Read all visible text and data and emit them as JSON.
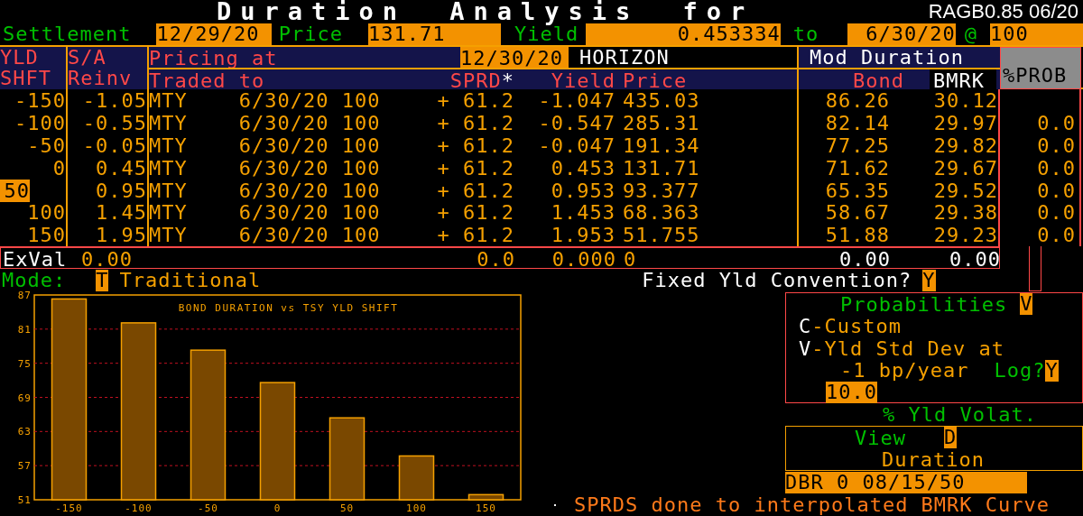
{
  "header": {
    "title": "Duration Analysis for",
    "security": "RAGB0.85 06/20"
  },
  "settlement": {
    "label": "Settlement",
    "value": "12/29/20"
  },
  "price": {
    "label": "Price",
    "value": "131.71"
  },
  "yield": {
    "label": "Yield",
    "value": "0.453334"
  },
  "to": {
    "label": "to",
    "value": "6/30/20"
  },
  "at": {
    "label": "@",
    "value": "100"
  },
  "table": {
    "yld_header": [
      "YLD",
      "SHFT"
    ],
    "sa_header": [
      "S/A",
      "Reinv"
    ],
    "pricing_label": "Pricing at",
    "pricing_date": "12/30/20",
    "horizon": "HORIZON",
    "traded_to": "Traded to",
    "sprd": "SPRD",
    "sprd_mark": "*",
    "yield": "Yield",
    "price": "Price",
    "mod_duration": "Mod Duration",
    "bond": "Bond",
    "bmrk": "BMRK",
    "prob": "%PROB",
    "rows": [
      {
        "shift": "-150",
        "reinv": "-1.05",
        "traded_to": "MTY    6/30/20 100",
        "sprd": "+ 61.2",
        "yield": "-1.047",
        "price": "435.03",
        "bond": "86.26",
        "bmrk": "30.12",
        "selected": false
      },
      {
        "shift": "-100",
        "reinv": "-0.55",
        "traded_to": "MTY    6/30/20 100",
        "sprd": "+ 61.2",
        "yield": "-0.547",
        "price": "285.31",
        "bond": "82.14",
        "bmrk": "29.97",
        "prob": "0.0",
        "selected": false
      },
      {
        "shift": "-50",
        "reinv": "-0.05",
        "traded_to": "MTY    6/30/20 100",
        "sprd": "+ 61.2",
        "yield": "-0.047",
        "price": "191.34",
        "bond": "77.25",
        "bmrk": "29.82",
        "prob": "0.0",
        "selected": false
      },
      {
        "shift": "0",
        "reinv": "0.45",
        "traded_to": "MTY    6/30/20 100",
        "sprd": "+ 61.2",
        "yield": "0.453",
        "price": "131.71",
        "bond": "71.62",
        "bmrk": "29.67",
        "prob": "0.0",
        "selected": false
      },
      {
        "shift": "50",
        "reinv": "0.95",
        "traded_to": "MTY    6/30/20 100",
        "sprd": "+ 61.2",
        "yield": "0.953",
        "price": "93.377",
        "bond": "65.35",
        "bmrk": "29.52",
        "prob": "0.0",
        "selected": true
      },
      {
        "shift": "100",
        "reinv": "1.45",
        "traded_to": "MTY    6/30/20 100",
        "sprd": "+ 61.2",
        "yield": "1.453",
        "price": "68.363",
        "bond": "58.67",
        "bmrk": "29.38",
        "prob": "0.0",
        "selected": false
      },
      {
        "shift": "150",
        "reinv": "1.95",
        "traded_to": "MTY    6/30/20 100",
        "sprd": "+ 61.2",
        "yield": "1.953",
        "price": "51.755",
        "bond": "51.88",
        "bmrk": "29.23",
        "prob": "0.0",
        "selected": false
      }
    ],
    "exval": {
      "label": "ExVal",
      "reinv": "0.00",
      "sprd": "0.0",
      "yield": "0.000",
      "price": "0",
      "bond": "0.00",
      "bmrk": "0.00"
    }
  },
  "mode": {
    "label": "Mode:",
    "code": "T",
    "value": "Traditional"
  },
  "fixed_yld": {
    "label": "Fixed Yld Convention?",
    "value": "Y"
  },
  "chart": {
    "chart_data": {
      "type": "bar",
      "title": "BOND DURATION vs TSY YLD SHIFT",
      "categories": [
        "-150",
        "-100",
        "-50",
        "0",
        "50",
        "100",
        "150"
      ],
      "values": [
        86.3,
        82.1,
        77.3,
        71.6,
        65.4,
        58.7,
        51.9
      ],
      "grid": true,
      "ylim": [
        51,
        87
      ],
      "yticks": [
        51,
        57,
        63,
        69,
        75,
        81,
        87
      ]
    }
  },
  "probabilities": {
    "title": "Probabilities",
    "code": "V",
    "options": [
      {
        "key": "C",
        "label": "-Custom"
      },
      {
        "key": "V",
        "label": "-Yld Std Dev at"
      }
    ],
    "rate": "-1 bp/year",
    "log_label": "Log?",
    "log_value": "Y",
    "volatility": "10.0",
    "volatility_label": "% Yld Volat."
  },
  "view": {
    "label": "View",
    "code": "D",
    "value": "Duration"
  },
  "benchmark": "DBR 0 08/15/50",
  "message": "SPRDS done to interpolated BMRK Curve"
}
